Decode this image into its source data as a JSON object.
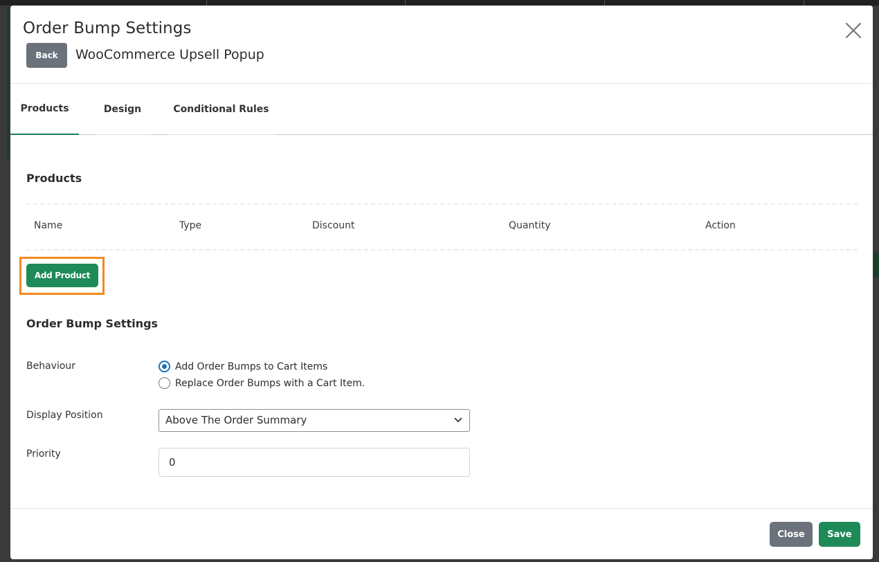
{
  "modal": {
    "title": "Order Bump Settings",
    "subtitle": "WooCommerce Upsell Popup",
    "back_label": "Back"
  },
  "tabs": [
    {
      "label": "Products",
      "active": true
    },
    {
      "label": "Design",
      "active": false
    },
    {
      "label": "Conditional Rules",
      "active": false
    }
  ],
  "products": {
    "title": "Products",
    "columns": [
      "Name",
      "Type",
      "Discount",
      "Quantity",
      "Action"
    ],
    "add_label": "Add Product"
  },
  "order_bump": {
    "title": "Order Bump Settings",
    "behaviour": {
      "label": "Behaviour",
      "options": [
        {
          "label": "Add Order Bumps to Cart Items",
          "checked": true
        },
        {
          "label": "Replace Order Bumps with a Cart Item.",
          "checked": false
        }
      ]
    },
    "display_position": {
      "label": "Display Position",
      "value": "Above The Order Summary"
    },
    "priority": {
      "label": "Priority",
      "value": "0"
    }
  },
  "footer": {
    "close_label": "Close",
    "save_label": "Save"
  },
  "colors": {
    "primary_green": "#1e8a58",
    "secondary_gray": "#6c727b",
    "highlight_orange": "#f5891f",
    "radio_blue": "#2271b1"
  },
  "icons": {
    "close": "close-icon",
    "dropdown": "chevron-down-icon"
  }
}
